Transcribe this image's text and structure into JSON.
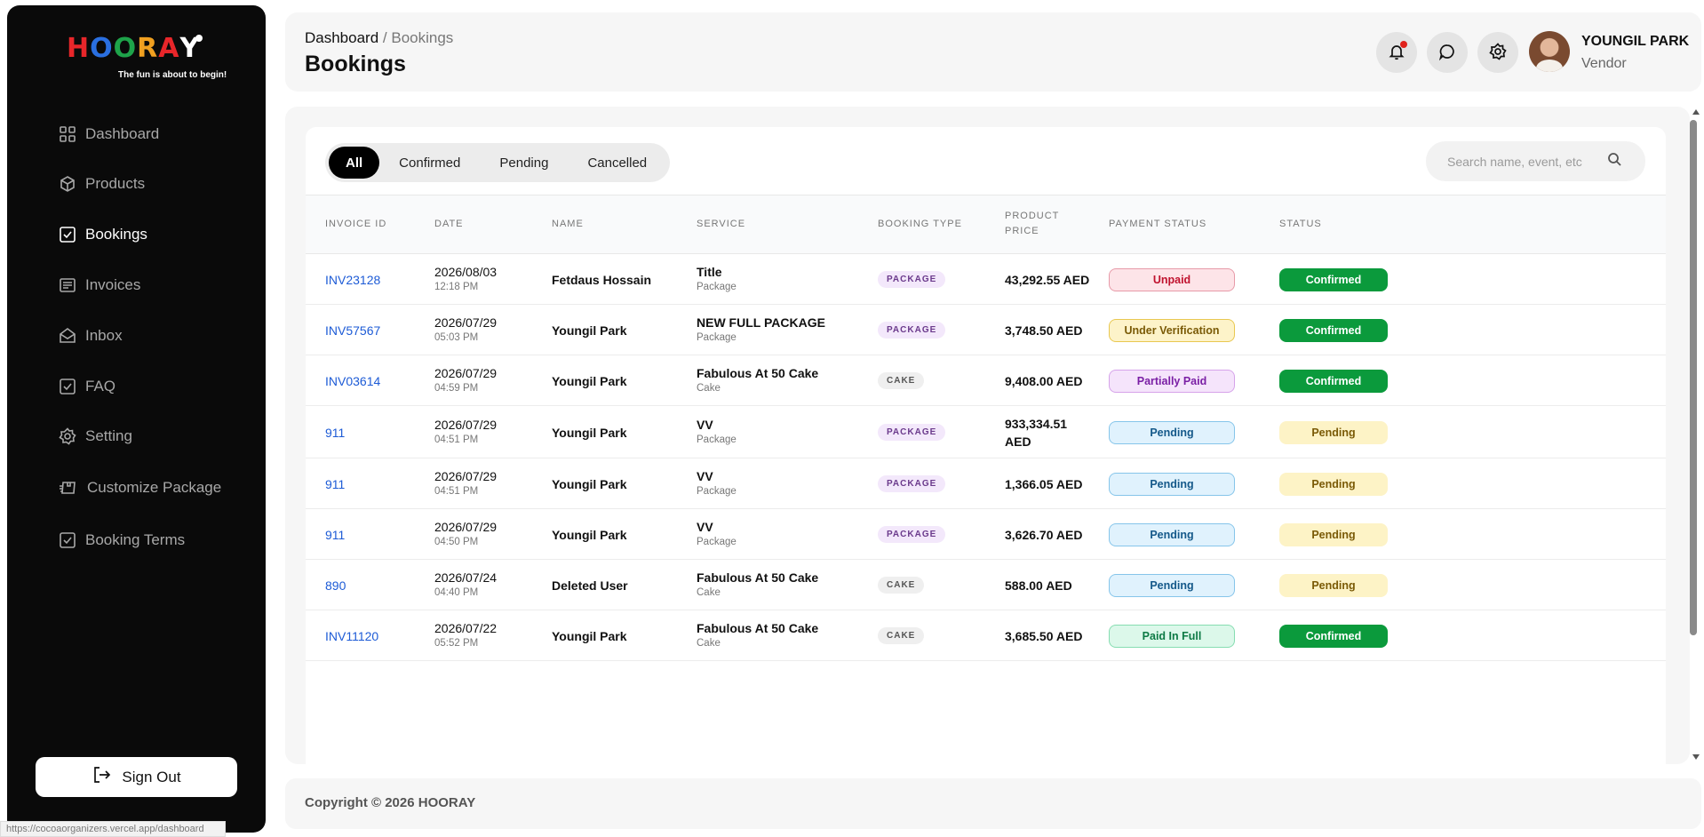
{
  "brand": {
    "letters": [
      {
        "ch": "H",
        "color": "#e8262a"
      },
      {
        "ch": "O",
        "color": "#2a6fe0"
      },
      {
        "ch": "O",
        "color": "#1ea34a"
      },
      {
        "ch": "R",
        "color": "#f0a020"
      },
      {
        "ch": "A",
        "color": "#e8262a"
      },
      {
        "ch": "Y",
        "color": "#ffffff"
      }
    ],
    "tagline": "The fun is about to begin!"
  },
  "sidebar": {
    "items": [
      {
        "label": "Dashboard",
        "icon": "grid-icon",
        "active": false
      },
      {
        "label": "Products",
        "icon": "box-icon",
        "active": false
      },
      {
        "label": "Bookings",
        "icon": "checkbox-icon",
        "active": true
      },
      {
        "label": "Invoices",
        "icon": "receipt-icon",
        "active": false
      },
      {
        "label": "Inbox",
        "icon": "mail-icon",
        "active": false
      },
      {
        "label": "FAQ",
        "icon": "checkbox-icon",
        "active": false
      },
      {
        "label": "Setting",
        "icon": "gear-icon",
        "active": false
      },
      {
        "label": "Customize Package",
        "icon": "package-truck-icon",
        "active": false
      },
      {
        "label": "Booking Terms",
        "icon": "checkbox-icon",
        "active": false
      }
    ],
    "signout_label": "Sign Out",
    "status_url": "https://cocoaorganizers.vercel.app/dashboard"
  },
  "header": {
    "crumb_root": "Dashboard",
    "crumb_sep": "/",
    "crumb_current": "Bookings",
    "title": "Bookings",
    "user_name": "YOUNGIL PARK",
    "user_role": "Vendor"
  },
  "filters": {
    "tabs": [
      "All",
      "Confirmed",
      "Pending",
      "Cancelled"
    ],
    "active": "All",
    "search_placeholder": "Search name, event, etc"
  },
  "table": {
    "columns": {
      "invoice": "INVOICE ID",
      "date": "DATE",
      "name": "NAME",
      "service": "SERVICE",
      "type": "BOOKING TYPE",
      "price_1": "PRODUCT",
      "price_2": "PRICE",
      "payment": "PAYMENT STATUS",
      "status": "STATUS"
    },
    "rows": [
      {
        "invoice": "INV23128",
        "date": "2026/08/03",
        "time": "12:18 PM",
        "name": "Fetdaus Hossain",
        "service": "Title",
        "service_sub": "Package",
        "type": "PACKAGE",
        "price": "43,292.55 AED",
        "payment": "Unpaid",
        "status": "Confirmed"
      },
      {
        "invoice": "INV57567",
        "date": "2026/07/29",
        "time": "05:03 PM",
        "name": "Youngil Park",
        "service": "NEW FULL PACKAGE",
        "service_sub": "Package",
        "type": "PACKAGE",
        "price": "3,748.50 AED",
        "payment": "Under Verification",
        "status": "Confirmed"
      },
      {
        "invoice": "INV03614",
        "date": "2026/07/29",
        "time": "04:59 PM",
        "name": "Youngil Park",
        "service": "Fabulous At 50 Cake",
        "service_sub": "Cake",
        "type": "CAKE",
        "price": "9,408.00 AED",
        "payment": "Partially Paid",
        "status": "Confirmed"
      },
      {
        "invoice": "911",
        "date": "2026/07/29",
        "time": "04:51 PM",
        "name": "Youngil Park",
        "service": "VV",
        "service_sub": "Package",
        "type": "PACKAGE",
        "price": "933,334.51 AED",
        "price_line1": "933,334.51",
        "price_line2": "AED",
        "payment": "Pending",
        "status": "Pending"
      },
      {
        "invoice": "911",
        "date": "2026/07/29",
        "time": "04:51 PM",
        "name": "Youngil Park",
        "service": "VV",
        "service_sub": "Package",
        "type": "PACKAGE",
        "price": "1,366.05 AED",
        "payment": "Pending",
        "status": "Pending"
      },
      {
        "invoice": "911",
        "date": "2026/07/29",
        "time": "04:50 PM",
        "name": "Youngil Park",
        "service": "VV",
        "service_sub": "Package",
        "type": "PACKAGE",
        "price": "3,626.70 AED",
        "payment": "Pending",
        "status": "Pending"
      },
      {
        "invoice": "890",
        "date": "2026/07/24",
        "time": "04:40 PM",
        "name": "Deleted User",
        "service": "Fabulous At 50 Cake",
        "service_sub": "Cake",
        "type": "CAKE",
        "price": "588.00 AED",
        "payment": "Pending",
        "status": "Pending"
      },
      {
        "invoice": "INV11120",
        "date": "2026/07/22",
        "time": "05:52 PM",
        "name": "Youngil Park",
        "service": "Fabulous At 50 Cake",
        "service_sub": "Cake",
        "type": "CAKE",
        "price": "3,685.50 AED",
        "payment": "Paid In Full",
        "status": "Confirmed"
      }
    ]
  },
  "footer": {
    "copyright": "Copyright © 2026 HOORAY"
  },
  "colors": {
    "sidebar_bg": "#0a0a0a",
    "link": "#1d5bd6",
    "confirmed": "#0b9a3c",
    "pending": "#fdf3c6"
  }
}
